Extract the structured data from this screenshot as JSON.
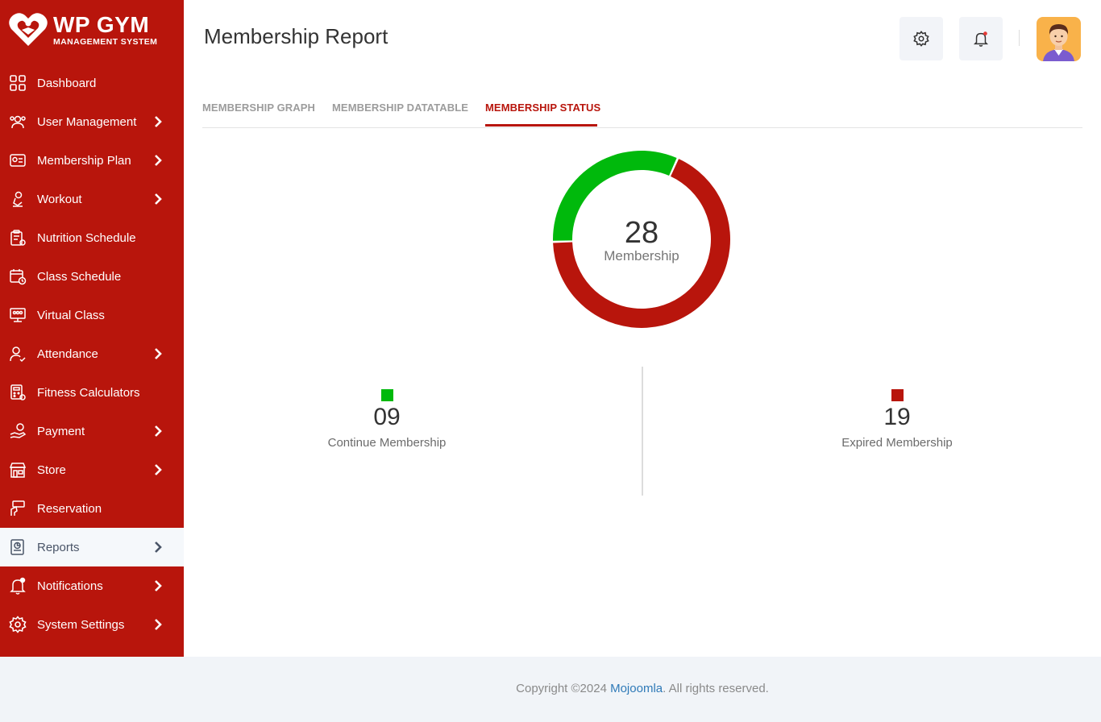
{
  "brand": {
    "title": "WP GYM",
    "subtitle": "MANAGEMENT SYSTEM"
  },
  "colors": {
    "sidebar": "#b8150c",
    "accent": "#b8150c",
    "continue": "#00b90c",
    "expired": "#b8150c"
  },
  "sidebar": {
    "items": [
      {
        "label": "Dashboard",
        "icon": "dashboard-grid-icon",
        "chevron": false
      },
      {
        "label": "User Management",
        "icon": "user-group-icon",
        "chevron": true
      },
      {
        "label": "Membership Plan",
        "icon": "membership-card-icon",
        "chevron": true
      },
      {
        "label": "Workout",
        "icon": "workout-icon",
        "chevron": true
      },
      {
        "label": "Nutrition Schedule",
        "icon": "nutrition-clipboard-icon",
        "chevron": false
      },
      {
        "label": "Class Schedule",
        "icon": "calendar-clock-icon",
        "chevron": false
      },
      {
        "label": "Virtual Class",
        "icon": "virtual-class-icon",
        "chevron": false
      },
      {
        "label": "Attendance",
        "icon": "attendance-user-check-icon",
        "chevron": true
      },
      {
        "label": "Fitness Calculators",
        "icon": "calculator-icon",
        "chevron": false
      },
      {
        "label": "Payment",
        "icon": "payment-hand-icon",
        "chevron": true
      },
      {
        "label": "Store",
        "icon": "store-icon",
        "chevron": true
      },
      {
        "label": "Reservation",
        "icon": "reservation-book-icon",
        "chevron": false
      },
      {
        "label": "Reports",
        "icon": "reports-icon",
        "chevron": true,
        "active": true
      },
      {
        "label": "Notifications",
        "icon": "bell-icon",
        "chevron": true
      },
      {
        "label": "System Settings",
        "icon": "gear-icon",
        "chevron": true
      }
    ]
  },
  "header": {
    "title": "Membership Report"
  },
  "tabs": [
    {
      "label": "MEMBERSHIP GRAPH"
    },
    {
      "label": "MEMBERSHIP DATATABLE"
    },
    {
      "label": "MEMBERSHIP STATUS",
      "active": true
    }
  ],
  "chart_data": {
    "type": "pie",
    "center_value": "28",
    "center_label": "Membership",
    "series": [
      {
        "name": "Continue Membership",
        "value": 9,
        "display": "09",
        "color": "#00b90c"
      },
      {
        "name": "Expired Membership",
        "value": 19,
        "display": "19",
        "color": "#b8150c"
      }
    ]
  },
  "footer": {
    "prefix": "Copyright ©2024 ",
    "link": "Mojoomla",
    "suffix": ". All rights reserved."
  }
}
